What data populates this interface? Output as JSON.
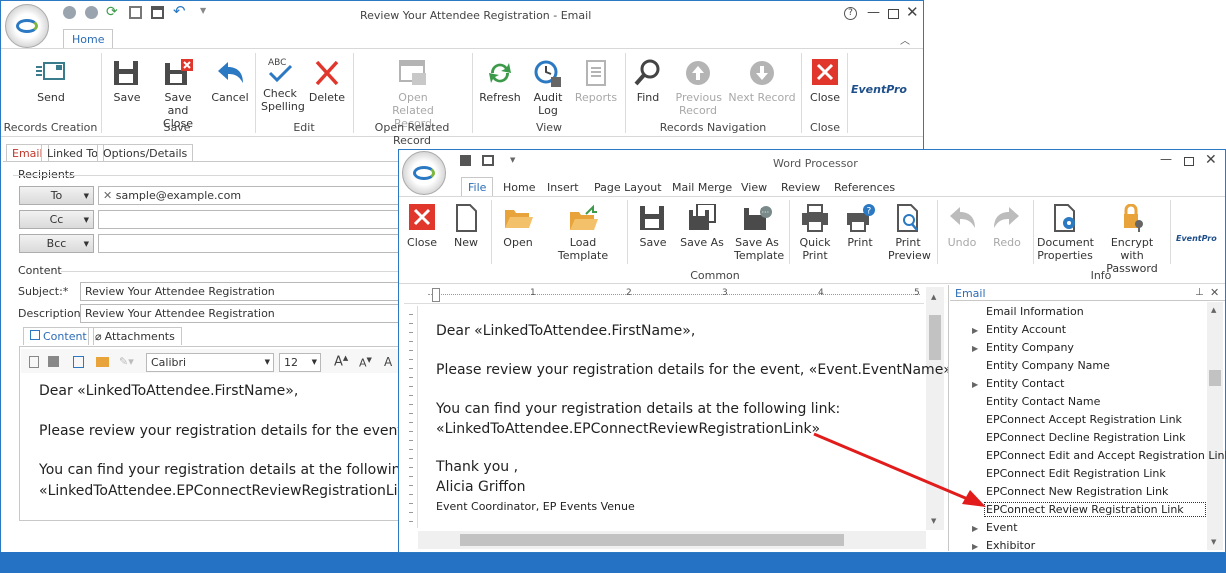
{
  "email_window": {
    "title": "Review Your Attendee Registration - Email",
    "tab_home": "Home",
    "buttons": {
      "send": "Send",
      "save": "Save",
      "save_close": "Save and Close",
      "cancel": "Cancel",
      "check_spelling": "Check Spelling",
      "delete": "Delete",
      "open_related": "Open Related Record",
      "refresh": "Refresh",
      "audit_log": "Audit Log",
      "reports": "Reports",
      "find": "Find",
      "previous_record": "Previous Record",
      "next_record": "Next Record",
      "close": "Close"
    },
    "groups": {
      "records_creation": "Records Creation",
      "save": "Save",
      "edit": "Edit",
      "open_related": "Open Related Record",
      "view": "View",
      "records_navigation": "Records Navigation",
      "close": "Close"
    },
    "brand": "EventPro",
    "form_tabs": [
      "Email",
      "Linked To",
      "Options/Details"
    ],
    "recipients_label": "Recipients",
    "to": "To",
    "cc": "Cc",
    "bcc": "Bcc",
    "to_value": "sample@example.com",
    "content_label": "Content",
    "subject_label": "Subject:*",
    "subject_value": "Review Your Attendee Registration",
    "description_label": "Description:",
    "description_value": "Review Your Attendee Registration",
    "content_tabs": [
      "Content",
      "Attachments"
    ],
    "font": "Calibri",
    "font_size": "12",
    "body": [
      "Dear «LinkedToAttendee.FirstName»,",
      "Please review your registration details for the event, «E",
      "You can find your registration details at the following lin",
      "«LinkedToAttendee.EPConnectReviewRegistrationLink»"
    ]
  },
  "word_window": {
    "title": "Word Processor",
    "tabs": [
      "File",
      "Home",
      "Insert",
      "Page Layout",
      "Mail Merge",
      "View",
      "Review",
      "References"
    ],
    "buttons": {
      "close": "Close",
      "new": "New",
      "open": "Open",
      "load_template": "Load Template",
      "save": "Save",
      "save_as": "Save As",
      "save_as_template": "Save As Template",
      "quick_print": "Quick Print",
      "print": "Print",
      "print_preview": "Print Preview",
      "undo": "Undo",
      "redo": "Redo",
      "document_properties": "Document Properties",
      "encrypt": "Encrypt with Password"
    },
    "groups": {
      "common": "Common",
      "info": "Info"
    },
    "brand": "EventPro",
    "ruler": [
      "1",
      "2",
      "3",
      "4",
      "5"
    ],
    "body": [
      "Dear «LinkedToAttendee.FirstName»,",
      "Please review your registration details for the event, «Event.EventName».",
      "You can find your registration details at the following link:",
      "«LinkedToAttendee.EPConnectReviewRegistrationLink»",
      "Thank you ,",
      "Alicia Griffon",
      "Event Coordinator, EP Events Venue"
    ],
    "panel_title": "Email",
    "tree": [
      {
        "label": "Email Information",
        "expand": false
      },
      {
        "label": "Entity Account",
        "expand": true
      },
      {
        "label": "Entity Company",
        "expand": true
      },
      {
        "label": "Entity Company Name",
        "expand": false
      },
      {
        "label": "Entity Contact",
        "expand": true
      },
      {
        "label": "Entity Contact Name",
        "expand": false
      },
      {
        "label": "EPConnect Accept Registration Link",
        "expand": false
      },
      {
        "label": "EPConnect Decline Registration Link",
        "expand": false
      },
      {
        "label": "EPConnect Edit and Accept Registration Link",
        "expand": false
      },
      {
        "label": "EPConnect Edit Registration Link",
        "expand": false
      },
      {
        "label": "EPConnect New Registration Link",
        "expand": false
      },
      {
        "label": "EPConnect Review Registration Link",
        "expand": false
      },
      {
        "label": "Event",
        "expand": true
      },
      {
        "label": "Exhibitor",
        "expand": true
      }
    ]
  },
  "colors": {
    "accent": "#2b79c2",
    "red": "#e0362c",
    "arrow": "#e21b1b"
  }
}
